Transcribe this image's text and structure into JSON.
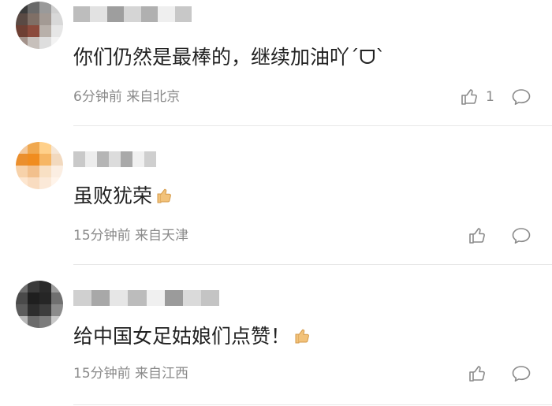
{
  "comments": [
    {
      "text": "你们仍然是最棒的，继续加油吖ˊᗜˋ",
      "time": "6分钟前",
      "location": "来自北京",
      "like_count": "1",
      "avatar_colors": [
        "#3b3b3b",
        "#6a6a6a",
        "#9a9a9a",
        "#cfcfcf",
        "#5a4a44",
        "#7f6f66",
        "#a39a94",
        "#d8d8d8",
        "#6e3f33",
        "#8b4a3c",
        "#b8b0aa",
        "#e6e6e6",
        "#a3928a",
        "#c7c0bb",
        "#dedede",
        "#f3f3f3"
      ],
      "name_colors": [
        "#bdbdbd",
        "#e2e2e2",
        "#9e9e9e",
        "#d5d5d5",
        "#b0b0b0",
        "#efefef",
        "#c8c8c8"
      ]
    },
    {
      "text": "虽败犹荣",
      "time": "15分钟前",
      "location": "来自天津",
      "like_count": "",
      "avatar_colors": [
        "#f3c89b",
        "#f0a84f",
        "#ffd08a",
        "#f5e6d6",
        "#eb8f2d",
        "#f08c1f",
        "#f6b664",
        "#f2d9be",
        "#f7d2aa",
        "#f2c08d",
        "#f8e0c4",
        "#fbeee2",
        "#fde6cf",
        "#f9dcc0",
        "#fbe9d8",
        "#fff4ea"
      ],
      "name_colors": [
        "#c9c9c9",
        "#ededed",
        "#b5b5b5",
        "#dcdcdc",
        "#a9a9a9",
        "#f0f0f0",
        "#cfcfcf"
      ]
    },
    {
      "text": "给中国女足姑娘们点赞！",
      "time": "15分钟前",
      "location": "来自江西",
      "like_count": "",
      "avatar_colors": [
        "#6e6e6e",
        "#3a3a3a",
        "#2b2b2b",
        "#9c9c9c",
        "#4a4a4a",
        "#1f1f1f",
        "#262626",
        "#707070",
        "#5c5c5c",
        "#2d2d2d",
        "#3d3d3d",
        "#8c8c8c",
        "#b7b7b7",
        "#6b6b6b",
        "#7c7c7c",
        "#c9c9c9"
      ],
      "name_colors": [
        "#d0d0d0",
        "#a8a8a8",
        "#e6e6e6",
        "#bcbcbc",
        "#f0f0f0",
        "#9b9b9b",
        "#dadada",
        "#c4c4c4"
      ]
    }
  ],
  "icons": {
    "like": "thumbs-up-outline",
    "reply": "speech-bubble-outline",
    "emoji": "thumbs-up-emoji"
  },
  "colors": {
    "text": "#222222",
    "meta": "#8a8a8a",
    "divider": "#e8e8e8",
    "emoji": "#f2c27a"
  }
}
